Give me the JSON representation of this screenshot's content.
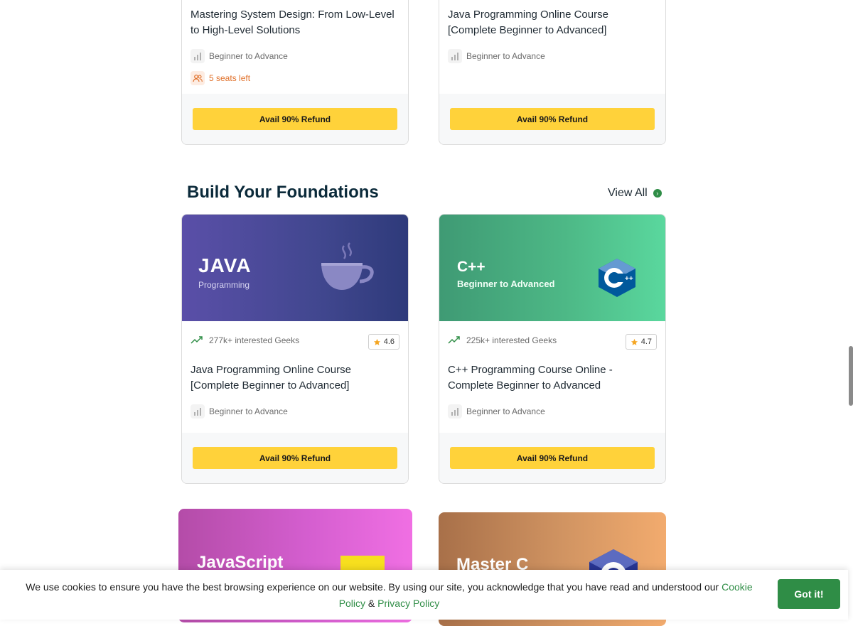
{
  "top_cards": [
    {
      "title": "Mastering System Design: From Low-Level to High-Level Solutions",
      "level": "Beginner to Advance",
      "seats": "5 seats left",
      "button": "Avail 90% Refund"
    },
    {
      "title": "Java Programming Online Course [Complete Beginner to Advanced]",
      "level": "Beginner to Advance",
      "button": "Avail 90% Refund"
    }
  ],
  "section": {
    "title": "Build Your Foundations",
    "view_all": "View All"
  },
  "foundation_cards": [
    {
      "banner_title": "JAVA",
      "banner_subtitle": "Programming",
      "interested": "277k+ interested Geeks",
      "rating": "4.6",
      "title": "Java Programming Online Course [Complete Beginner to Advanced]",
      "level": "Beginner to Advance",
      "button": "Avail 90% Refund"
    },
    {
      "banner_title": "C++",
      "banner_subtitle": "Beginner to Advanced",
      "interested": "225k+ interested Geeks",
      "rating": "4.7",
      "title": "C++ Programming Course Online - Complete Beginner to Advanced",
      "level": "Beginner to Advance",
      "button": "Avail 90% Refund"
    }
  ],
  "bottom_cards": [
    {
      "banner_title": "JavaScript"
    },
    {
      "banner_title": "Master C"
    }
  ],
  "cookie": {
    "text": "We use cookies to ensure you have the best browsing experience on our website. By using our site, you acknowledge that you have read and understood our ",
    "cookie_policy": "Cookie Policy",
    "amp": " & ",
    "privacy_policy": "Privacy Policy",
    "button": "Got it!"
  },
  "colors": {
    "accent": "#2f8d46",
    "button_yellow": "#ffd23a",
    "seats_orange": "#e0702a"
  }
}
